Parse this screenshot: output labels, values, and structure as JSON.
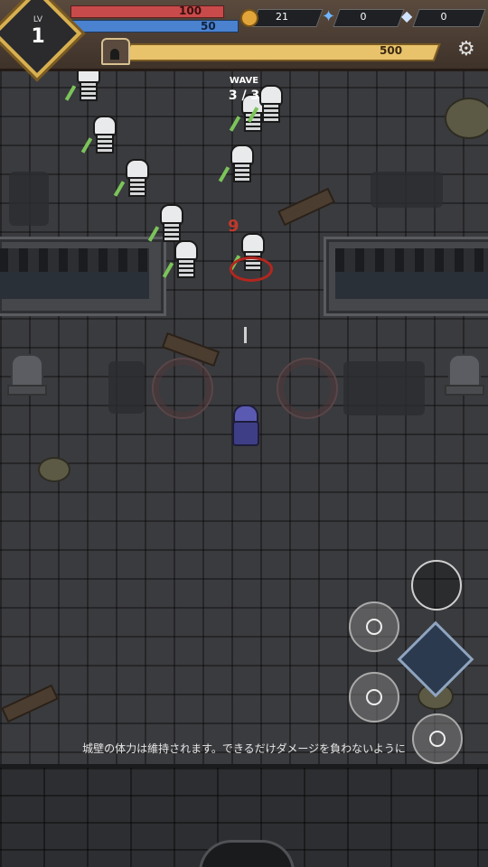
{
  "hud": {
    "level_label": "LV",
    "level_value": "1",
    "hp": "100",
    "mp": "50",
    "coins": "21",
    "stars": "0",
    "gems": "0",
    "castle_hp": "500"
  },
  "wave": {
    "label": "WAVE",
    "count": "3 / 3"
  },
  "battle": {
    "damage_number": "9"
  },
  "hint": {
    "text": "城壁の体力は維持されます。できるだけダメージを負わないように"
  },
  "colors": {
    "hp": "#c94a4a",
    "mp": "#4a82d0",
    "castle": "#e8c36c",
    "accent_gold": "#d8b050"
  },
  "icons": [
    "coin-icon",
    "star-icon",
    "gem-icon",
    "castle-icon",
    "gear-icon"
  ]
}
